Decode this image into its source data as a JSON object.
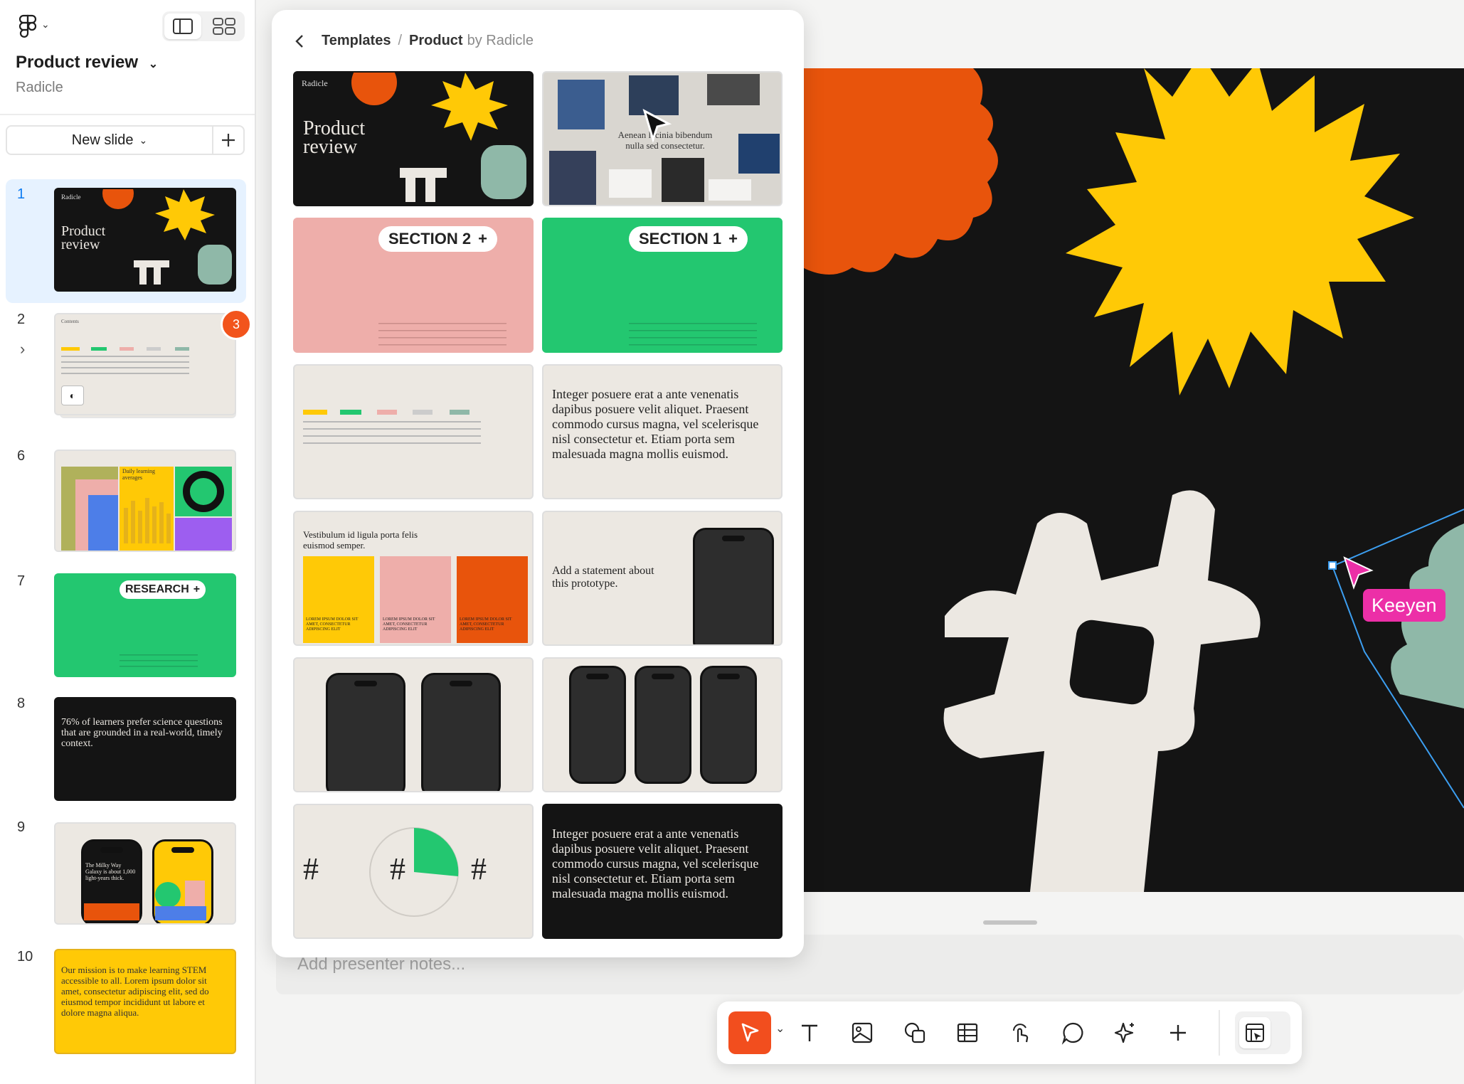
{
  "sidebar": {
    "doc_title": "Product review",
    "doc_subtitle": "Radicle",
    "new_slide_label": "New slide",
    "slides": [
      {
        "num": "1",
        "kind": "cover",
        "title": "Product\nreview",
        "brand": "Radicle"
      },
      {
        "num": "2",
        "kind": "table",
        "badge": "3",
        "brand": "Contents"
      },
      {
        "num": "6",
        "kind": "charts",
        "caption": "Daily learning averages"
      },
      {
        "num": "7",
        "kind": "section",
        "pill": "RESEARCH"
      },
      {
        "num": "8",
        "kind": "quote",
        "text": "76% of learners prefer science questions that are grounded in a real-world, timely context."
      },
      {
        "num": "9",
        "kind": "phones",
        "text": "The Milky Way Galaxy is about 1,000 light-years thick."
      },
      {
        "num": "10",
        "kind": "mission",
        "text": "Our mission is to make learning STEM accessible to all. Lorem ipsum dolor sit amet, consectetur adipiscing elit, sed do eiusmod tempor incididunt ut labore et dolore magna aliqua."
      }
    ]
  },
  "panel": {
    "crumb_root": "Templates",
    "crumb_sep": "/",
    "crumb_current": "Product",
    "crumb_by": "by Radicle",
    "templates": {
      "cover_title": "Product\nreview",
      "cover_brand": "Radicle",
      "collage_text": "Aenean lacinia bibendum nulla sed consectetur.",
      "section2": "SECTION 2",
      "section1": "SECTION 1",
      "body_text": "Integer posuere erat a ante venenatis dapibus posuere velit aliquet. Praesent commodo cursus magna, vel scelerisque nisl consectetur et. Etiam porta sem malesuada magna mollis euismod.",
      "swatch_heading": "Vestibulum id ligula porta felis euismod semper.",
      "swatch_caption": "LOREM IPSUM DOLOR SIT AMET, CONSECTETUR ADIPISCING ELIT",
      "statement": "Add a statement about this prototype.",
      "hash": "#",
      "dark_text": "Integer posuere erat a ante venenatis dapibus posuere velit aliquet. Praesent commodo cursus magna, vel scelerisque nisl consectetur et. Etiam porta sem malesuada magna mollis euismod."
    }
  },
  "notes": {
    "placeholder": "Add presenter notes..."
  },
  "collaborator": {
    "name": "Keeyen",
    "color": "#ec2fa7"
  },
  "toolbar": {
    "tools": [
      "move-tool",
      "text-tool",
      "image-tool",
      "shape-tool",
      "table-tool",
      "interact-tool",
      "comment-tool",
      "ai-tool",
      "add-tool",
      "dev-mode-tool"
    ],
    "active": "move-tool",
    "accent": "#f24e1e"
  },
  "colors": {
    "orange": "#e8540c",
    "yellow": "#ffc906",
    "sage": "#8fb8a8",
    "cream": "#ece8e2",
    "pink": "#eeaeaa",
    "green": "#23c770",
    "black": "#141414"
  }
}
